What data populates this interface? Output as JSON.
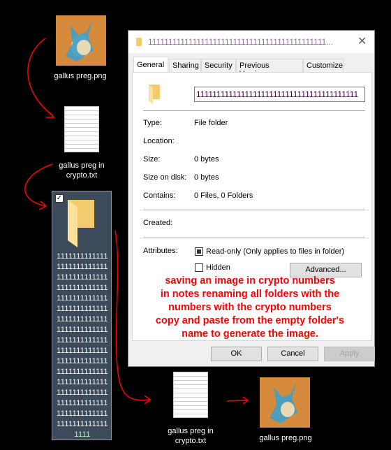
{
  "desktop": {
    "items": [
      {
        "label": "gallus preg.png"
      },
      {
        "label": "gallus preg in crypto.txt"
      },
      {
        "label": "gallus preg in crypto.txt"
      },
      {
        "label": "gallus preg.png"
      }
    ],
    "selected_folder": {
      "name_lines": [
        "1111111111111",
        "1111111111111",
        "1111111111111",
        "1111111111111",
        "1111111111111",
        "1111111111111",
        "1111111111111",
        "1111111111111",
        "1111111111111",
        "1111111111111",
        "1111111111111",
        "1111111111111",
        "1111111111111",
        "1111111111111",
        "1111111111111",
        "1111111111111",
        "1111111111111"
      ],
      "name_last_line": "1111",
      "checked": true
    },
    "arrow_color": "#ff0000"
  },
  "dialog": {
    "title": "11111111111111111111111111111111111111111111...",
    "close_icon": "close-icon",
    "tabs": [
      {
        "label": "General",
        "active": true
      },
      {
        "label": "Sharing"
      },
      {
        "label": "Security"
      },
      {
        "label": "Previous Versions"
      },
      {
        "label": "Customize"
      }
    ],
    "name_value": "1111111111111111111111111111111111111111",
    "props": [
      {
        "label": "Type:",
        "value": "File folder"
      },
      {
        "label": "Location:",
        "value": ""
      },
      {
        "label": "Size:",
        "value": "0 bytes"
      },
      {
        "label": "Size on disk:",
        "value": "0 bytes"
      },
      {
        "label": "Contains:",
        "value": "0 Files, 0 Folders"
      },
      {
        "label": "Created:",
        "value": ""
      }
    ],
    "attributes_label": "Attributes:",
    "readonly_label": "Read-only (Only applies to files in folder)",
    "readonly_state": "indeterminate",
    "hidden_label": "Hidden",
    "hidden_checked": false,
    "advanced_label": "Advanced...",
    "ok_label": "OK",
    "cancel_label": "Cancel",
    "apply_label": "Apply",
    "apply_enabled": false
  },
  "annotation": {
    "lines": [
      "saving an image in crypto numbers",
      "in notes renaming all folders with the",
      "numbers with the crypto numbers",
      "copy and paste from the empty folder's",
      "name to generate the image."
    ],
    "color": "#ff0000"
  }
}
